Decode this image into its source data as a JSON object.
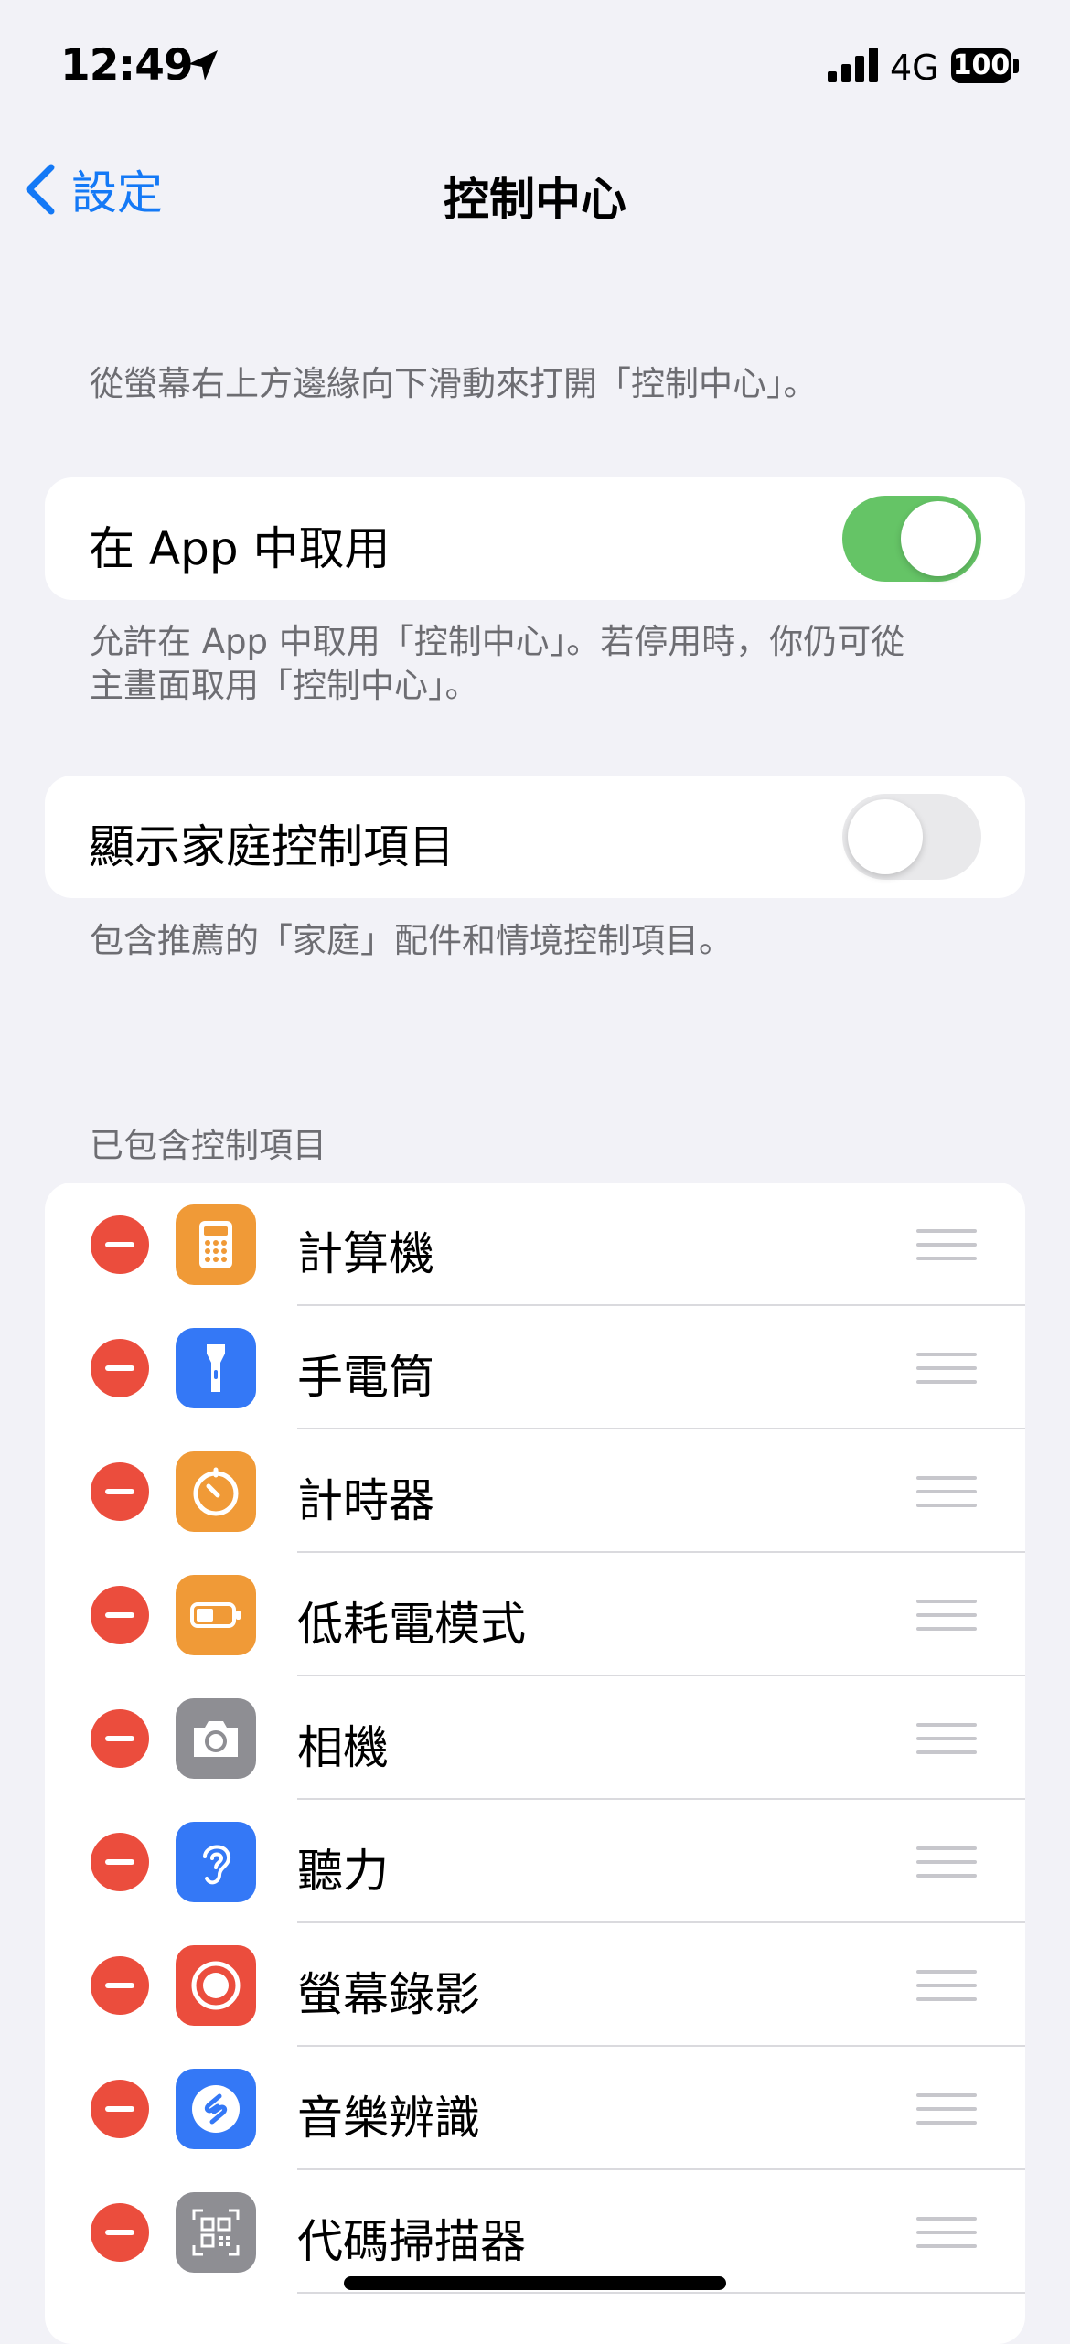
{
  "status_bar": {
    "time": "12:49",
    "network": "4G",
    "battery": "100"
  },
  "nav": {
    "back_label": "設定",
    "title": "控制中心"
  },
  "intro": "從螢幕右上方邊緣向下滑動來打開「控制中心」。",
  "access_in_apps": {
    "label": "在 App 中取用",
    "enabled": true,
    "footer_line1": "允許在 App 中取用「控制中心」。若停用時，你仍可從",
    "footer_line2": "主畫面取用「控制中心」。"
  },
  "home_controls": {
    "label": "顯示家庭控制項目",
    "enabled": false,
    "footer": "包含推薦的「家庭」配件和情境控制項目。"
  },
  "included": {
    "header": "已包含控制項目",
    "items": [
      {
        "label": "計算機",
        "icon": "calculator-icon",
        "color": "#f09a37"
      },
      {
        "label": "手電筒",
        "icon": "flashlight-icon",
        "color": "#3478f6"
      },
      {
        "label": "計時器",
        "icon": "timer-icon",
        "color": "#f09a37"
      },
      {
        "label": "低耗電模式",
        "icon": "battery-icon",
        "color": "#f09a37"
      },
      {
        "label": "相機",
        "icon": "camera-icon",
        "color": "#8e8e93"
      },
      {
        "label": "聽力",
        "icon": "ear-icon",
        "color": "#3478f6"
      },
      {
        "label": "螢幕錄影",
        "icon": "record-icon",
        "color": "#eb4d3d"
      },
      {
        "label": "音樂辨識",
        "icon": "shazam-icon",
        "color": "#3478f6"
      },
      {
        "label": "代碼掃描器",
        "icon": "qr-code-icon",
        "color": "#8e8e93"
      }
    ]
  }
}
